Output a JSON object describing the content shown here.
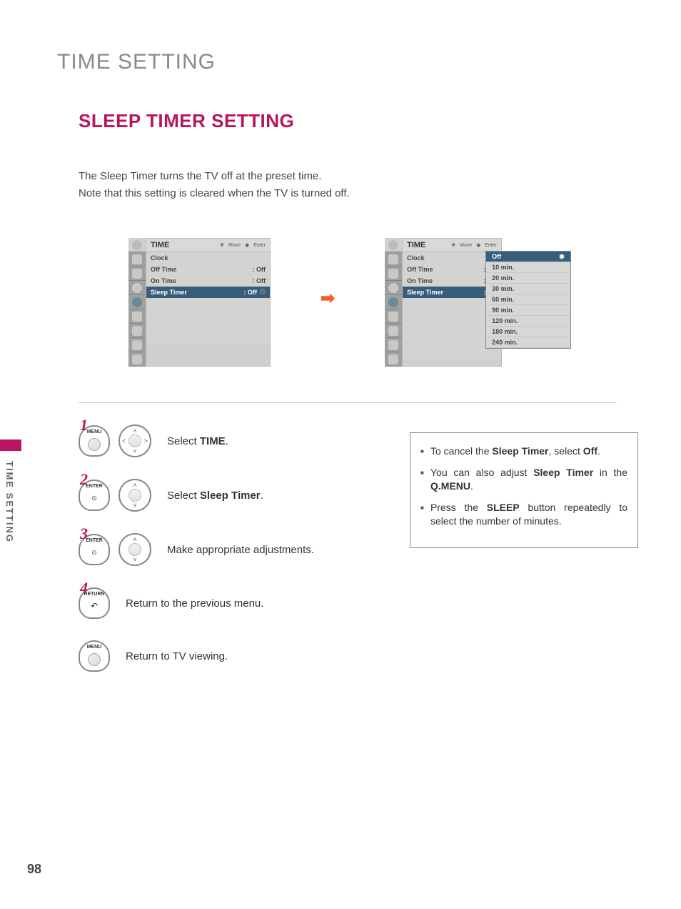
{
  "page": {
    "title": "TIME SETTING",
    "subtitle": "SLEEP TIMER SETTING",
    "intro1": "The Sleep Timer turns the TV off at the preset time.",
    "intro2": "Note that this setting is cleared when the TV is turned off.",
    "side_label": "TIME SETTING",
    "number": "98"
  },
  "menu": {
    "header_title": "TIME",
    "help_move": "Move",
    "help_enter": "Enter",
    "rows": [
      {
        "label": "Clock",
        "value": ""
      },
      {
        "label": "Off Time",
        "value": ": Off"
      },
      {
        "label": "On Time",
        "value": ": Off"
      },
      {
        "label": "Sleep Timer",
        "value": ": Off"
      }
    ]
  },
  "dropdown_options": [
    "Off",
    "10 min.",
    "20 min.",
    "30 min.",
    "60 min.",
    "90 min.",
    "120 min.",
    "180 min.",
    "240 min."
  ],
  "steps": {
    "s1_num": "1",
    "s1_btn": "MENU",
    "s1_text_pre": "Select ",
    "s1_text_bold": "TIME",
    "s1_text_post": ".",
    "s2_num": "2",
    "s2_btn": "ENTER",
    "s2_text_pre": "Select ",
    "s2_text_bold": "Sleep Timer",
    "s2_text_post": ".",
    "s3_num": "3",
    "s3_btn": "ENTER",
    "s3_text": "Make appropriate adjustments.",
    "s4_num": "4",
    "s4_btn": "RETURN",
    "s4_text": "Return to the previous menu.",
    "s5_btn": "MENU",
    "s5_text": "Return to TV viewing."
  },
  "notes": {
    "n1_pre": "To cancel the ",
    "n1_b1": "Sleep Timer",
    "n1_mid": ", select ",
    "n1_b2": "Off",
    "n1_post": ".",
    "n2_pre": "You can also adjust ",
    "n2_b1": "Sleep Timer",
    "n2_mid": " in the ",
    "n2_b2": "Q.MENU",
    "n2_post": ".",
    "n3_pre": "Press the ",
    "n3_b1": "SLEEP",
    "n3_post": " button repeatedly to select the number of minutes."
  }
}
